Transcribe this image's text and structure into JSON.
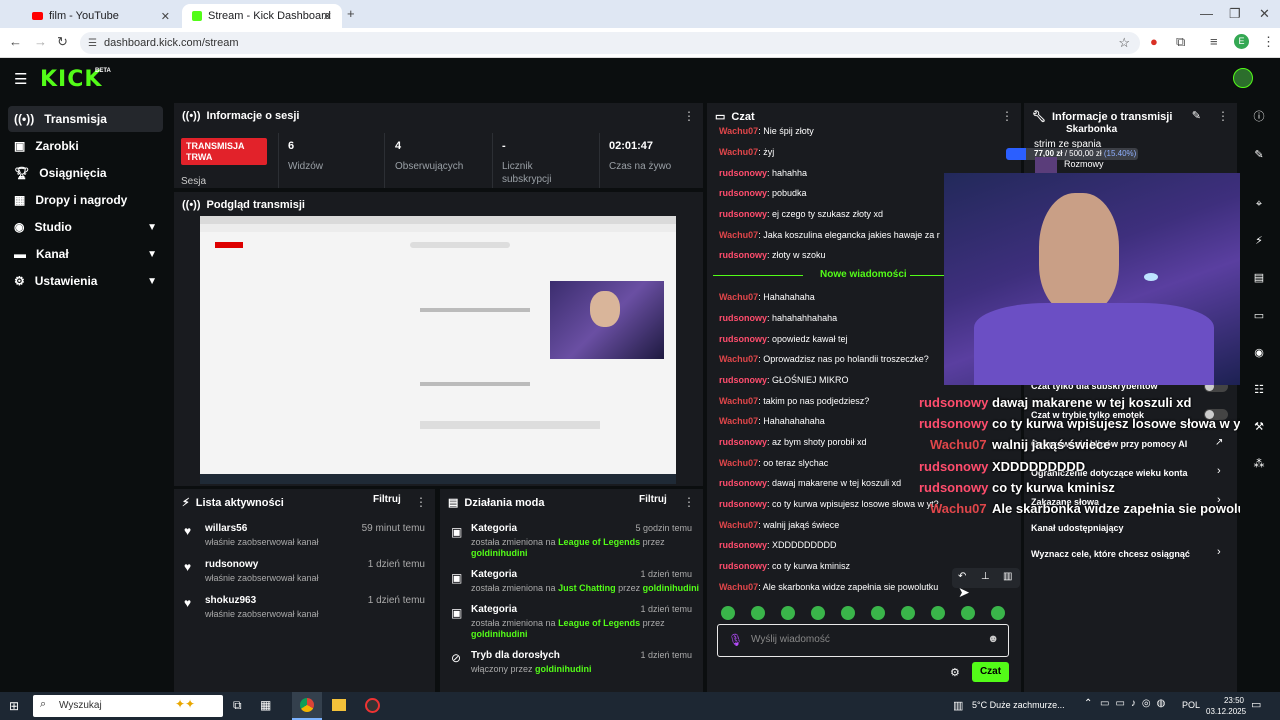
{
  "browser": {
    "tabs": [
      {
        "title": "film - YouTube",
        "active": false
      },
      {
        "title": "Stream - Kick Dashboard",
        "active": true
      }
    ],
    "url": "dashboard.kick.com/stream",
    "profile_initial": "E"
  },
  "header": {
    "logo": "KICK",
    "beta": "BETA"
  },
  "sidebar": {
    "items": [
      {
        "label": "Transmisja",
        "active": true,
        "icon": "broadcast-icon"
      },
      {
        "label": "Zarobki",
        "icon": "wallet-icon"
      },
      {
        "label": "Osiągnięcia",
        "icon": "trophy-icon"
      },
      {
        "label": "Dropy i nagrody",
        "icon": "gift-icon"
      },
      {
        "label": "Studio",
        "icon": "studio-icon",
        "chevron": true
      },
      {
        "label": "Kanał",
        "icon": "channel-icon",
        "chevron": true
      },
      {
        "label": "Ustawienia",
        "icon": "gear-icon",
        "chevron": true
      }
    ]
  },
  "session": {
    "title": "Informacje o sesji",
    "live_badge": "TRANSMISJA TRWA",
    "session_label": "Sesja",
    "stats": [
      {
        "value": "6",
        "label": "Widzów"
      },
      {
        "value": "4",
        "label": "Obserwujących"
      },
      {
        "value": "-",
        "label": "Licznik subskrypcji"
      },
      {
        "value": "02:01:47",
        "label": "Czas na żywo"
      }
    ]
  },
  "preview": {
    "title": "Podgląd transmisji"
  },
  "activity": {
    "title": "Lista aktywności",
    "filter": "Filtruj",
    "items": [
      {
        "user": "willars56",
        "text": "właśnie zaobserwował kanał",
        "time": "59 minut temu"
      },
      {
        "user": "rudsonowy",
        "text": "właśnie zaobserwował kanał",
        "time": "1 dzień temu"
      },
      {
        "user": "shokuz963",
        "text": "właśnie zaobserwował kanał",
        "time": "1 dzień temu"
      }
    ]
  },
  "mod": {
    "title": "Działania moda",
    "filter": "Filtruj",
    "items": [
      {
        "title": "Kategoria",
        "time": "5 godzin temu",
        "l1a": "została zmieniona na ",
        "l1b": "League of Legends",
        "l1c": " przez",
        "l2": "goldinihudini"
      },
      {
        "title": "Kategoria",
        "time": "1 dzień temu",
        "l1a": "została zmieniona na ",
        "l1b": "Just Chatting",
        "l1c": " przez ",
        "l2": "goldinihudini"
      },
      {
        "title": "Kategoria",
        "time": "1 dzień temu",
        "l1a": "została zmieniona na ",
        "l1b": "League of Legends",
        "l1c": " przez",
        "l2": "goldinihudini"
      },
      {
        "title": "Tryb dla dorosłych",
        "time": "1 dzień temu",
        "l1a": "włączony przez ",
        "l1b": "goldinihudini",
        "l1c": "",
        "l2": ""
      }
    ]
  },
  "chat": {
    "title": "Czat",
    "new_messages": "Nowe wiadomości",
    "input_placeholder": "Wyślij wiadomość",
    "send": "Czat",
    "messages": [
      {
        "user": "Wachu07",
        "text": ": Nie śpij złoty",
        "color": "#e0464a"
      },
      {
        "user": "Wachu07",
        "text": ": żyj",
        "color": "#e0464a"
      },
      {
        "user": "rudsonowy",
        "text": ": hahahha",
        "color": "#ff4d6d"
      },
      {
        "user": "rudsonowy",
        "text": ": pobudka",
        "color": "#ff4d6d"
      },
      {
        "user": "rudsonowy",
        "text": ": ej czego ty szukasz złoty xd",
        "color": "#ff4d6d"
      },
      {
        "user": "Wachu07",
        "text": ": Jaka koszulina elegancka jakies hawaje za r",
        "color": "#e0464a"
      },
      {
        "user": "rudsonowy",
        "text": ": złoty w szoku",
        "color": "#ff4d6d"
      },
      {
        "user": "Wachu07",
        "text": ": Hahahahaha",
        "color": "#e0464a"
      },
      {
        "user": "rudsonowy",
        "text": ": hahahahhahaha",
        "color": "#ff4d6d"
      },
      {
        "user": "rudsonowy",
        "text": ": opowiedz kawał tej",
        "color": "#ff4d6d"
      },
      {
        "user": "Wachu07",
        "text": ": Oprowadzisz nas po holandii troszeczke?",
        "color": "#e0464a"
      },
      {
        "user": "rudsonowy",
        "text": ": GŁOŚNIEJ MIKRO",
        "color": "#ff4d6d"
      },
      {
        "user": "Wachu07",
        "text": ": takim po nas podjedziesz?",
        "color": "#e0464a"
      },
      {
        "user": "Wachu07",
        "text": ": Hahahahahaha",
        "color": "#e0464a"
      },
      {
        "user": "rudsonowy",
        "text": ": az bym shoty porobił xd",
        "color": "#ff4d6d"
      },
      {
        "user": "Wachu07",
        "text": ": oo teraz slychac",
        "color": "#e0464a"
      },
      {
        "user": "rudsonowy",
        "text": ": dawaj makarene w tej koszuli xd",
        "color": "#ff4d6d"
      },
      {
        "user": "rudsonowy",
        "text": ": co ty kurwa wpisujesz losowe słowa w yt?",
        "color": "#ff4d6d"
      },
      {
        "user": "Wachu07",
        "text": ": walnij jakąś świece",
        "color": "#e0464a"
      },
      {
        "user": "rudsonowy",
        "text": ": XDDDDDDDDD",
        "color": "#ff4d6d"
      },
      {
        "user": "rudsonowy",
        "text": ": co ty kurwa kminisz",
        "color": "#ff4d6d"
      },
      {
        "user": "Wachu07",
        "text": ": Ale skarbonka widze zapełnia sie powolutku",
        "color": "#e0464a"
      }
    ]
  },
  "stream_info": {
    "title": "Informacje o transmisji",
    "piggy_title": "Skarbonka",
    "piggy_name": "strim ze spania",
    "piggy_amount": "77,00 zł",
    "piggy_goal": "/ 500,00 zł",
    "piggy_pct": "(15.40%)",
    "piggy_progress": 0.154,
    "category": "Rozmowy",
    "settings": [
      {
        "label": "Czat tylko dla subskrybentów",
        "type": "toggle"
      },
      {
        "label": "Czat w trybie tylko emotek",
        "type": "toggle"
      },
      {
        "label": "Generowanie klipów przy pomocy AI",
        "type": "link"
      },
      {
        "label": "Ograniczenie dotyczące wieku konta",
        "type": "chevron"
      },
      {
        "label": "Zakazane słowa",
        "type": "chevron"
      },
      {
        "label": "Kanał udostępniający",
        "type": "none"
      },
      {
        "label": "Wyznacz cele, które chcesz osiągnąć",
        "type": "chevron"
      }
    ]
  },
  "overlay": {
    "lines": [
      {
        "user": "rudsonowy",
        "text": "dawaj makarene w tej koszuli xd"
      },
      {
        "user": "rudsonowy",
        "text": "co ty kurwa wpisujesz losowe słowa w yt?"
      },
      {
        "user": "Wachu07",
        "text": "walnij jakąś świece"
      },
      {
        "user": "rudsonowy",
        "text": "XDDDDDDDDD"
      },
      {
        "user": "rudsonowy",
        "text": "co ty kurwa kminisz"
      },
      {
        "user": "Wachu07",
        "text": "Ale skarbonka widze zapełnia sie powolutku"
      }
    ]
  },
  "taskbar": {
    "search": "Wyszukaj",
    "weather": "5°C  Duże zachmurze...",
    "lang": "POL",
    "time": "23:50",
    "date": "03.12.2025"
  }
}
